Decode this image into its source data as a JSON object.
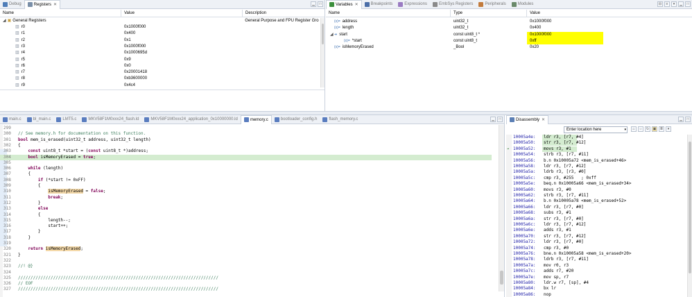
{
  "colors": {
    "tab_bg": "#eef1f6",
    "highlight_yellow": "#ffff00",
    "current_line_green": "#d4ecd0",
    "code_current_line": "#e8f2fe",
    "keyword": "#7f0055",
    "comment": "#3f7f5f",
    "address": "#1a1aa6"
  },
  "top_left": {
    "tabs": [
      {
        "label": "Debug",
        "icon": "debug-icon",
        "active": false
      },
      {
        "label": "Registers",
        "icon": "registers-icon",
        "active": true,
        "close": "✕"
      }
    ],
    "columns": [
      "Name",
      "Value",
      "Description"
    ],
    "group": {
      "name": "General Registers",
      "description": "General Purpose and FPU Register Gro"
    },
    "rows": [
      {
        "name": "r0",
        "value": "0x1000f000"
      },
      {
        "name": "r1",
        "value": "0x400"
      },
      {
        "name": "r2",
        "value": "0x1"
      },
      {
        "name": "r3",
        "value": "0x1000f000"
      },
      {
        "name": "r4",
        "value": "0x1000695d"
      },
      {
        "name": "r5",
        "value": "0x9"
      },
      {
        "name": "r6",
        "value": "0x0"
      },
      {
        "name": "r7",
        "value": "0x20001418"
      },
      {
        "name": "r8",
        "value": "0xb3600000"
      },
      {
        "name": "r9",
        "value": "0x4c4"
      }
    ]
  },
  "top_right": {
    "tabs": [
      {
        "label": "Variables",
        "icon": "variables-icon",
        "active": true,
        "close": "✕"
      },
      {
        "label": "Breakpoints",
        "icon": "breakpoints-icon",
        "active": false
      },
      {
        "label": "Expressions",
        "icon": "expressions-icon",
        "active": false
      },
      {
        "label": "EmbSys Registers",
        "icon": "embsys-icon",
        "active": false
      },
      {
        "label": "Peripherals",
        "icon": "peripherals-icon",
        "active": false
      },
      {
        "label": "Modules",
        "icon": "modules-icon",
        "active": false
      }
    ],
    "columns": [
      "Name",
      "Type",
      "Value"
    ],
    "rows": [
      {
        "indent": 0,
        "expander": "",
        "icon": "(x)=",
        "name": "address",
        "type": "uint32_t",
        "value": "0x1000f000",
        "highlight": false
      },
      {
        "indent": 0,
        "expander": "",
        "icon": "(x)=",
        "name": "length",
        "type": "uint32_t",
        "value": "0x400",
        "highlight": false
      },
      {
        "indent": 0,
        "expander": "◢",
        "icon": "➜",
        "name": "start",
        "type": "const uint8_t *",
        "value": "0x1000f000",
        "highlight": true
      },
      {
        "indent": 1,
        "expander": "",
        "icon": "(x)=",
        "name": "*start",
        "type": "const uint8_t",
        "value": "0xff",
        "highlight": true
      },
      {
        "indent": 0,
        "expander": "",
        "icon": "(x)=",
        "name": "isMemoryErased",
        "type": "_Bool",
        "value": "0x20",
        "highlight": false
      }
    ]
  },
  "editor": {
    "tabs": [
      {
        "label": "main.c",
        "active": false
      },
      {
        "label": "bl_main.c",
        "active": false
      },
      {
        "label": "LMT5.c",
        "active": false
      },
      {
        "label": "MKV58F1M0xxx24_flash.ld",
        "active": false
      },
      {
        "label": "MKV58F1M0xxx24_application_0x10000000.ld",
        "active": false
      },
      {
        "label": "memory.c",
        "active": true
      },
      {
        "label": "bootloader_config.h",
        "active": false
      },
      {
        "label": "flash_memory.c",
        "active": false
      }
    ],
    "lines": [
      {
        "n": "299",
        "t": ""
      },
      {
        "n": "300",
        "t": "// See memory.h for documentation on this function."
      },
      {
        "n": "301",
        "t": "bool mem_is_erased(uint32_t address, uint32_t length)"
      },
      {
        "n": "302",
        "t": "{"
      },
      {
        "n": "303",
        "t": "    const uint8_t *start = (const uint8_t *)address;"
      },
      {
        "n": "304",
        "t": "    bool isMemoryErased = true;"
      },
      {
        "n": "305",
        "t": ""
      },
      {
        "n": "306",
        "t": "    while (length)"
      },
      {
        "n": "307",
        "t": "    {"
      },
      {
        "n": "308",
        "t": "        if (*start != 0xFF)"
      },
      {
        "n": "309",
        "t": "        {"
      },
      {
        "n": "310",
        "t": "            isMemoryErased = false;"
      },
      {
        "n": "311",
        "t": "            break;"
      },
      {
        "n": "312",
        "t": "        }"
      },
      {
        "n": "313",
        "t": "        else"
      },
      {
        "n": "314",
        "t": "        {"
      },
      {
        "n": "315",
        "t": "            length--;"
      },
      {
        "n": "316",
        "t": "            start++;"
      },
      {
        "n": "317",
        "t": "        }"
      },
      {
        "n": "318",
        "t": "    }"
      },
      {
        "n": "319",
        "t": ""
      },
      {
        "n": "320",
        "t": "    return isMemoryErased;"
      },
      {
        "n": "321",
        "t": "}"
      },
      {
        "n": "322",
        "t": ""
      },
      {
        "n": "323",
        "t": "//! @}"
      },
      {
        "n": "324",
        "t": ""
      },
      {
        "n": "325",
        "t": "////////////////////////////////////////////////////////////////////////////////"
      },
      {
        "n": "326",
        "t": "// EOF"
      },
      {
        "n": "327",
        "t": "////////////////////////////////////////////////////////////////////////////////"
      }
    ]
  },
  "disassembly": {
    "tab": {
      "label": "Disassembly",
      "close": "✕"
    },
    "location_placeholder": "Enter location here",
    "lines": [
      {
        "addr": "10005a4e:",
        "instr": "ldr r3, [r7, #4]",
        "highlight": true
      },
      {
        "addr": "10005a50:",
        "instr": "str r3, [r7, #12]",
        "highlight": true
      },
      {
        "addr": "10005a52:",
        "instr": "movs r3, #1",
        "highlight": true
      },
      {
        "addr": "10005a54:",
        "instr": "strb r3, [r7, #11]",
        "highlight": false
      },
      {
        "addr": "10005a56:",
        "instr": "b.n 0x10005a72 <mem_is_erased+46>",
        "highlight": false
      },
      {
        "addr": "10005a58:",
        "instr": "ldr r3, [r7, #12]",
        "highlight": false
      },
      {
        "addr": "10005a5a:",
        "instr": "ldrb r3, [r3, #0]",
        "highlight": false
      },
      {
        "addr": "10005a5c:",
        "instr": "cmp r3, #255   ; 0xff",
        "highlight": false
      },
      {
        "addr": "10005a5e:",
        "instr": "beq.n 0x10005a66 <mem_is_erased+34>",
        "highlight": false
      },
      {
        "addr": "10005a60:",
        "instr": "movs r3, #0",
        "highlight": false
      },
      {
        "addr": "10005a62:",
        "instr": "strb r3, [r7, #11]",
        "highlight": false
      },
      {
        "addr": "10005a64:",
        "instr": "b.n 0x10005a78 <mem_is_erased+52>",
        "highlight": false
      },
      {
        "addr": "10005a66:",
        "instr": "ldr r3, [r7, #0]",
        "highlight": false
      },
      {
        "addr": "10005a68:",
        "instr": "subs r3, #1",
        "highlight": false
      },
      {
        "addr": "10005a6a:",
        "instr": "str r3, [r7, #0]",
        "highlight": false
      },
      {
        "addr": "10005a6c:",
        "instr": "ldr r3, [r7, #12]",
        "highlight": false
      },
      {
        "addr": "10005a6e:",
        "instr": "adds r3, #1",
        "highlight": false
      },
      {
        "addr": "10005a70:",
        "instr": "str r3, [r7, #12]",
        "highlight": false
      },
      {
        "addr": "10005a72:",
        "instr": "ldr r3, [r7, #0]",
        "highlight": false
      },
      {
        "addr": "10005a74:",
        "instr": "cmp r3, #0",
        "highlight": false
      },
      {
        "addr": "10005a76:",
        "instr": "bne.n 0x10005a58 <mem_is_erased+20>",
        "highlight": false
      },
      {
        "addr": "10005a78:",
        "instr": "ldrb r3, [r7, #11]",
        "highlight": false
      },
      {
        "addr": "10005a7a:",
        "instr": "mov r0, r3",
        "highlight": false
      },
      {
        "addr": "10005a7c:",
        "instr": "adds r7, #20",
        "highlight": false
      },
      {
        "addr": "10005a7e:",
        "instr": "mov sp, r7",
        "highlight": false
      },
      {
        "addr": "10005a80:",
        "instr": "ldr.w r7, [sp], #4",
        "highlight": false
      },
      {
        "addr": "10005a84:",
        "instr": "bx lr",
        "highlight": false
      },
      {
        "addr": "10005a86:",
        "instr": "nop",
        "highlight": false
      },
      {
        "addr": "",
        "instr": "normal_mem_init:",
        "highlight": false
      }
    ]
  }
}
